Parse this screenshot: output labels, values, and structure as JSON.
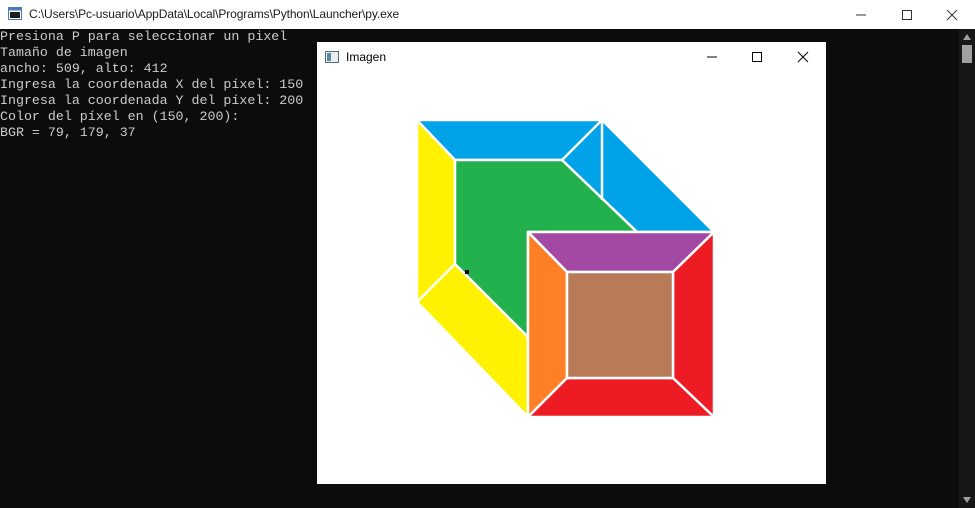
{
  "console_window": {
    "title": "C:\\Users\\Pc-usuario\\AppData\\Local\\Programs\\Python\\Launcher\\py.exe",
    "lines": [
      "Presiona P para seleccionar un pixel",
      "Tamaño de imagen",
      "ancho: 509, alto: 412",
      "Ingresa la coordenada X del píxel: 150",
      "Ingresa la coordenada Y del píxel: 200",
      "Color del píxel en (150, 200):",
      "BGR = 79, 179, 37"
    ]
  },
  "image_window": {
    "title": "Imagen",
    "cube_colors": {
      "top": "#00a2e8",
      "left": "#fff200",
      "back": "#22b14c",
      "inner_top": "#a349a4",
      "inner_left": "#ff7f27",
      "right": "#ed1c24",
      "bottom": "#ed1c24",
      "inner_back": "#b97a57",
      "edge": "#ffffff"
    }
  }
}
